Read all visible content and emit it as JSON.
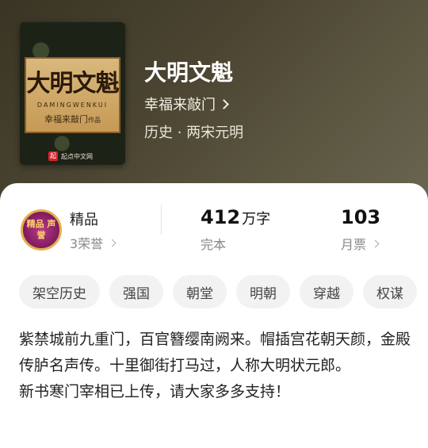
{
  "book": {
    "title": "大明文魁",
    "author": "幸福来敲门",
    "genre": "历史 · 两宋元明",
    "cover": {
      "title": "大明文魁",
      "pinyin": "DAMINGWENKUI",
      "author": "幸福来敲门",
      "author_suffix": "作品",
      "publisher": "起点中文网",
      "publisher_mark": "起"
    }
  },
  "stats": {
    "badge_text": "精品 声誉",
    "honor_label": "精品",
    "honor_sub": "3荣誉",
    "words_value": "412",
    "words_unit": "万字",
    "words_sub": "完本",
    "tickets_value": "103",
    "tickets_sub": "月票"
  },
  "tags": [
    "架空历史",
    "强国",
    "朝堂",
    "明朝",
    "穿越",
    "权谋"
  ],
  "description": [
    "紫禁城前九重门，百官簪缨南阙来。帽插宫花朝天颜，金殿传胪名声传。十里御街打马过，人称大明状元郎。",
    "新书寒门宰相已上传，请大家多多支持！"
  ],
  "colors": {
    "hero_bg": "#4a4431",
    "badge": "#7e1b5f",
    "badge_ring": "#e3b04b",
    "tag_bg": "#f2f2f2"
  }
}
